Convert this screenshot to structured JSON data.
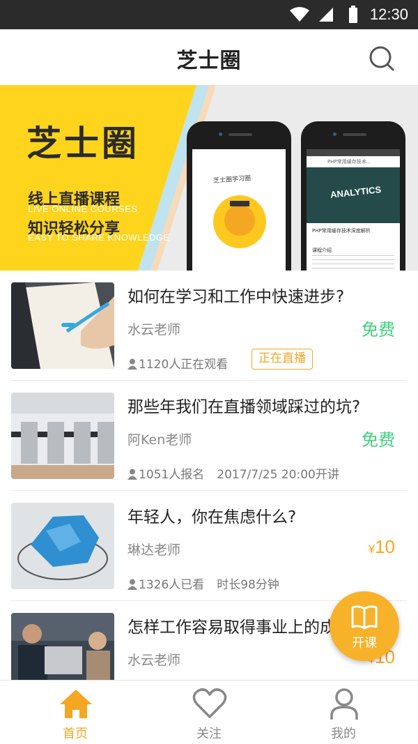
{
  "status_bar": {
    "time": "12:30"
  },
  "header": {
    "title": "芝士圈"
  },
  "banner": {
    "logo_text": "芝士圈",
    "line1": "线上直播课程",
    "line1_en": "LIVE ONLINE COURSES",
    "line2": "知识轻松分享",
    "line2_en": "EASY TO SHARE KNOWLEDGE",
    "phone1_tag": "芝士圈学习圈",
    "phone2_nav": "PHP常用缓存技术...",
    "phone2_image_word": "ANALYTICS",
    "phone2_title": "PHP常用缓存技术深度解析",
    "phone2_section": "课程介绍"
  },
  "courses": [
    {
      "title": "如何在学习和工作中快速进步?",
      "teacher": "水云老师",
      "price": "免费",
      "meta": "1120人正在观看",
      "badge": "正在直播"
    },
    {
      "title": "那些年我们在直播领域踩过的坑?",
      "teacher": "阿Ken老师",
      "price": "免费",
      "meta": "1051人报名",
      "extra": "2017/7/25  20:00开讲"
    },
    {
      "title": "年轻人，你在焦虑什么?",
      "teacher": "琳达老师",
      "price_symbol": "¥",
      "price_value": "10",
      "meta": "1326人已看",
      "extra": "时长98分钟"
    },
    {
      "title": "怎样工作容易取得事业上的成功?",
      "teacher": "水云老师",
      "price_symbol": "¥",
      "price_value": "10"
    }
  ],
  "fab": {
    "label": "开课"
  },
  "tabs": [
    {
      "label": "首页",
      "active": true
    },
    {
      "label": "关注",
      "active": false
    },
    {
      "label": "我的",
      "active": false
    }
  ],
  "colors": {
    "accent": "#f5a623",
    "free_green": "#3ed07e",
    "banner_yellow": "#ffd41c",
    "status_bar": "#2b2b2b"
  },
  "icons": [
    "wifi-icon",
    "signal-icon",
    "battery-icon",
    "search-icon",
    "person-icon",
    "book-icon",
    "home-icon",
    "heart-icon",
    "user-icon"
  ]
}
